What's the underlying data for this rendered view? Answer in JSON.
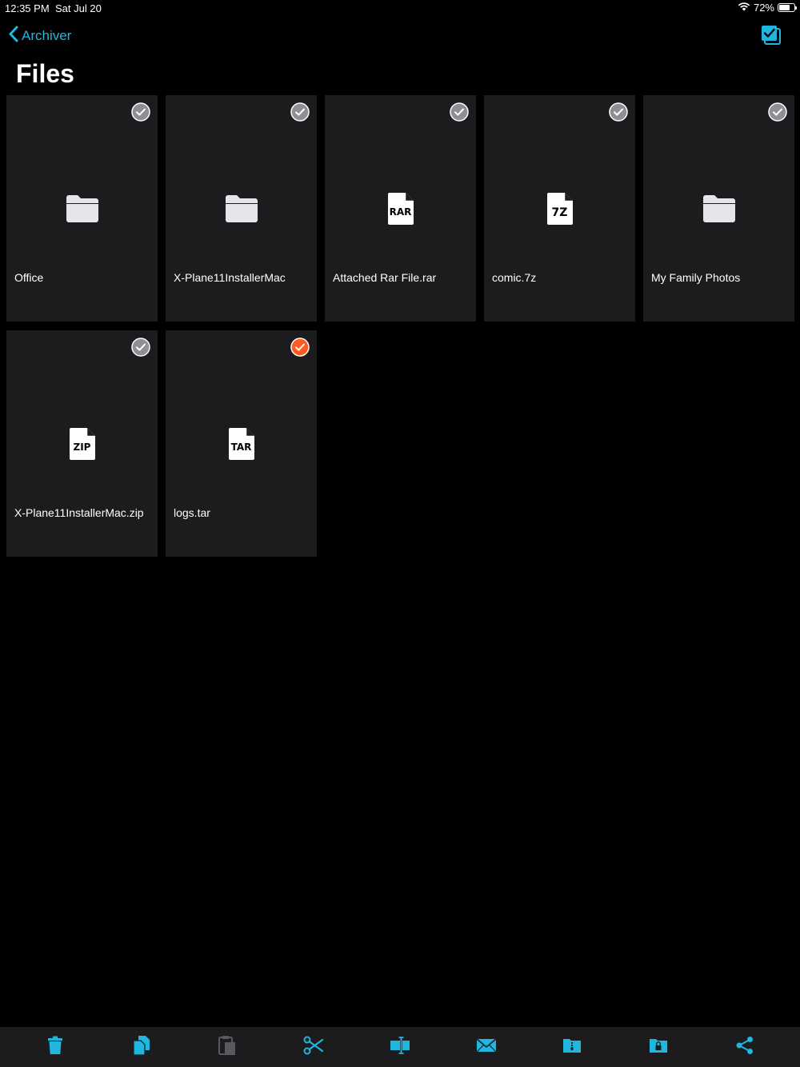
{
  "status_bar": {
    "time": "12:35 PM",
    "date": "Sat Jul 20",
    "battery": "72%",
    "battery_level": 0.72
  },
  "nav": {
    "back_label": "Archiver",
    "back_icon": "chevron-left-icon",
    "select_icon": "select-all-checkbox-icon"
  },
  "title": "Files",
  "files": [
    {
      "name": "Office",
      "kind": "folder",
      "badge": "",
      "selected": false
    },
    {
      "name": "X-Plane11InstallerMac",
      "kind": "folder",
      "badge": "",
      "selected": false
    },
    {
      "name": "Attached Rar File.rar",
      "kind": "archive",
      "badge": "RAR",
      "selected": false
    },
    {
      "name": "comic.7z",
      "kind": "archive",
      "badge": "7Z",
      "selected": false
    },
    {
      "name": "My Family Photos",
      "kind": "folder",
      "badge": "",
      "selected": false
    },
    {
      "name": "X-Plane11InstallerMac.zip",
      "kind": "archive",
      "badge": "ZIP",
      "selected": false
    },
    {
      "name": "logs.tar",
      "kind": "archive",
      "badge": "TAR",
      "selected": true
    }
  ],
  "toolbar": [
    {
      "icon": "trash-icon",
      "enabled": true
    },
    {
      "icon": "copy-icon",
      "enabled": true
    },
    {
      "icon": "paste-icon",
      "enabled": false
    },
    {
      "icon": "scissors-icon",
      "enabled": true
    },
    {
      "icon": "rename-icon",
      "enabled": true
    },
    {
      "icon": "mail-icon",
      "enabled": true
    },
    {
      "icon": "zip-folder-icon",
      "enabled": true
    },
    {
      "icon": "lock-folder-icon",
      "enabled": true
    },
    {
      "icon": "share-icon",
      "enabled": true
    }
  ],
  "colors": {
    "accent": "#1fb6e0",
    "selected": "#ff5a1f",
    "unselected_check": "#8e8e93",
    "tile_bg": "#1c1c1e",
    "icon_fill": "#e5e5ea",
    "disabled": "#5a5a5e"
  }
}
